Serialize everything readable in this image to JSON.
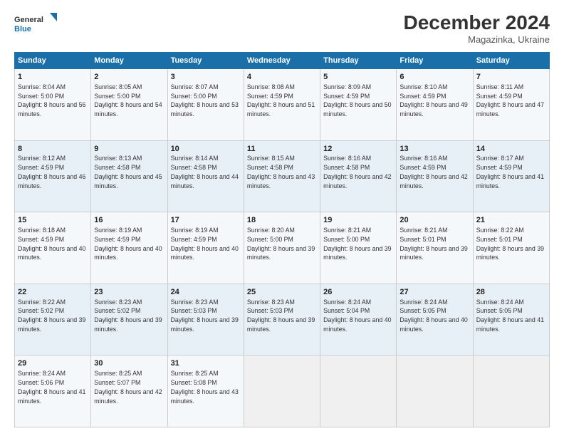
{
  "header": {
    "logo_line1": "General",
    "logo_line2": "Blue",
    "month": "December 2024",
    "location": "Magazinka, Ukraine"
  },
  "weekdays": [
    "Sunday",
    "Monday",
    "Tuesday",
    "Wednesday",
    "Thursday",
    "Friday",
    "Saturday"
  ],
  "weeks": [
    [
      {
        "day": "1",
        "sunrise": "Sunrise: 8:04 AM",
        "sunset": "Sunset: 5:00 PM",
        "daylight": "Daylight: 8 hours and 56 minutes."
      },
      {
        "day": "2",
        "sunrise": "Sunrise: 8:05 AM",
        "sunset": "Sunset: 5:00 PM",
        "daylight": "Daylight: 8 hours and 54 minutes."
      },
      {
        "day": "3",
        "sunrise": "Sunrise: 8:07 AM",
        "sunset": "Sunset: 5:00 PM",
        "daylight": "Daylight: 8 hours and 53 minutes."
      },
      {
        "day": "4",
        "sunrise": "Sunrise: 8:08 AM",
        "sunset": "Sunset: 4:59 PM",
        "daylight": "Daylight: 8 hours and 51 minutes."
      },
      {
        "day": "5",
        "sunrise": "Sunrise: 8:09 AM",
        "sunset": "Sunset: 4:59 PM",
        "daylight": "Daylight: 8 hours and 50 minutes."
      },
      {
        "day": "6",
        "sunrise": "Sunrise: 8:10 AM",
        "sunset": "Sunset: 4:59 PM",
        "daylight": "Daylight: 8 hours and 49 minutes."
      },
      {
        "day": "7",
        "sunrise": "Sunrise: 8:11 AM",
        "sunset": "Sunset: 4:59 PM",
        "daylight": "Daylight: 8 hours and 47 minutes."
      }
    ],
    [
      {
        "day": "8",
        "sunrise": "Sunrise: 8:12 AM",
        "sunset": "Sunset: 4:59 PM",
        "daylight": "Daylight: 8 hours and 46 minutes."
      },
      {
        "day": "9",
        "sunrise": "Sunrise: 8:13 AM",
        "sunset": "Sunset: 4:58 PM",
        "daylight": "Daylight: 8 hours and 45 minutes."
      },
      {
        "day": "10",
        "sunrise": "Sunrise: 8:14 AM",
        "sunset": "Sunset: 4:58 PM",
        "daylight": "Daylight: 8 hours and 44 minutes."
      },
      {
        "day": "11",
        "sunrise": "Sunrise: 8:15 AM",
        "sunset": "Sunset: 4:58 PM",
        "daylight": "Daylight: 8 hours and 43 minutes."
      },
      {
        "day": "12",
        "sunrise": "Sunrise: 8:16 AM",
        "sunset": "Sunset: 4:58 PM",
        "daylight": "Daylight: 8 hours and 42 minutes."
      },
      {
        "day": "13",
        "sunrise": "Sunrise: 8:16 AM",
        "sunset": "Sunset: 4:59 PM",
        "daylight": "Daylight: 8 hours and 42 minutes."
      },
      {
        "day": "14",
        "sunrise": "Sunrise: 8:17 AM",
        "sunset": "Sunset: 4:59 PM",
        "daylight": "Daylight: 8 hours and 41 minutes."
      }
    ],
    [
      {
        "day": "15",
        "sunrise": "Sunrise: 8:18 AM",
        "sunset": "Sunset: 4:59 PM",
        "daylight": "Daylight: 8 hours and 40 minutes."
      },
      {
        "day": "16",
        "sunrise": "Sunrise: 8:19 AM",
        "sunset": "Sunset: 4:59 PM",
        "daylight": "Daylight: 8 hours and 40 minutes."
      },
      {
        "day": "17",
        "sunrise": "Sunrise: 8:19 AM",
        "sunset": "Sunset: 4:59 PM",
        "daylight": "Daylight: 8 hours and 40 minutes."
      },
      {
        "day": "18",
        "sunrise": "Sunrise: 8:20 AM",
        "sunset": "Sunset: 5:00 PM",
        "daylight": "Daylight: 8 hours and 39 minutes."
      },
      {
        "day": "19",
        "sunrise": "Sunrise: 8:21 AM",
        "sunset": "Sunset: 5:00 PM",
        "daylight": "Daylight: 8 hours and 39 minutes."
      },
      {
        "day": "20",
        "sunrise": "Sunrise: 8:21 AM",
        "sunset": "Sunset: 5:01 PM",
        "daylight": "Daylight: 8 hours and 39 minutes."
      },
      {
        "day": "21",
        "sunrise": "Sunrise: 8:22 AM",
        "sunset": "Sunset: 5:01 PM",
        "daylight": "Daylight: 8 hours and 39 minutes."
      }
    ],
    [
      {
        "day": "22",
        "sunrise": "Sunrise: 8:22 AM",
        "sunset": "Sunset: 5:02 PM",
        "daylight": "Daylight: 8 hours and 39 minutes."
      },
      {
        "day": "23",
        "sunrise": "Sunrise: 8:23 AM",
        "sunset": "Sunset: 5:02 PM",
        "daylight": "Daylight: 8 hours and 39 minutes."
      },
      {
        "day": "24",
        "sunrise": "Sunrise: 8:23 AM",
        "sunset": "Sunset: 5:03 PM",
        "daylight": "Daylight: 8 hours and 39 minutes."
      },
      {
        "day": "25",
        "sunrise": "Sunrise: 8:23 AM",
        "sunset": "Sunset: 5:03 PM",
        "daylight": "Daylight: 8 hours and 39 minutes."
      },
      {
        "day": "26",
        "sunrise": "Sunrise: 8:24 AM",
        "sunset": "Sunset: 5:04 PM",
        "daylight": "Daylight: 8 hours and 40 minutes."
      },
      {
        "day": "27",
        "sunrise": "Sunrise: 8:24 AM",
        "sunset": "Sunset: 5:05 PM",
        "daylight": "Daylight: 8 hours and 40 minutes."
      },
      {
        "day": "28",
        "sunrise": "Sunrise: 8:24 AM",
        "sunset": "Sunset: 5:05 PM",
        "daylight": "Daylight: 8 hours and 41 minutes."
      }
    ],
    [
      {
        "day": "29",
        "sunrise": "Sunrise: 8:24 AM",
        "sunset": "Sunset: 5:06 PM",
        "daylight": "Daylight: 8 hours and 41 minutes."
      },
      {
        "day": "30",
        "sunrise": "Sunrise: 8:25 AM",
        "sunset": "Sunset: 5:07 PM",
        "daylight": "Daylight: 8 hours and 42 minutes."
      },
      {
        "day": "31",
        "sunrise": "Sunrise: 8:25 AM",
        "sunset": "Sunset: 5:08 PM",
        "daylight": "Daylight: 8 hours and 43 minutes."
      },
      null,
      null,
      null,
      null
    ]
  ]
}
